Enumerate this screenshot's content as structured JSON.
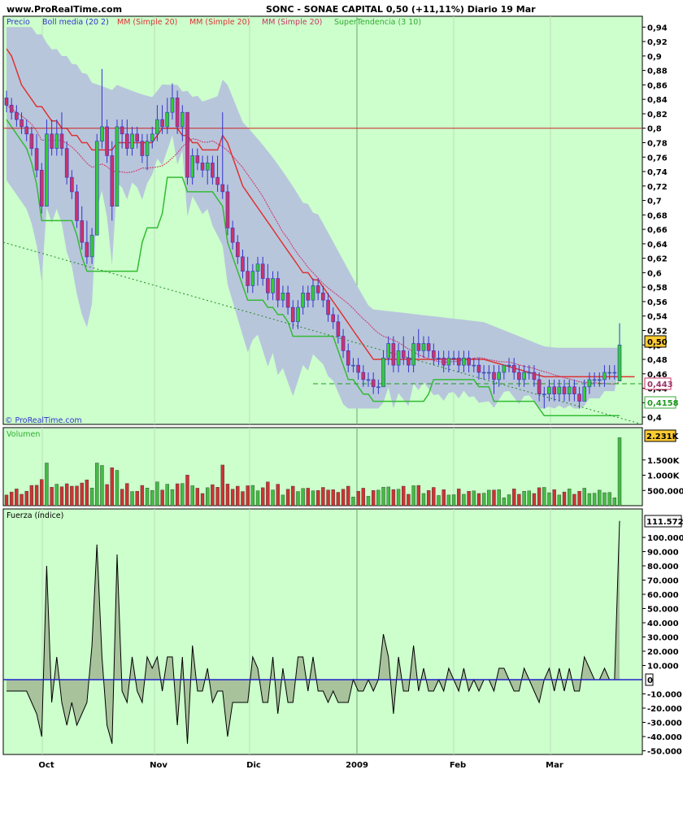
{
  "header": {
    "site": "www.ProRealTime.com",
    "title": "SONC - SONAE CAPITAL    0,50 (+11,11%)    Diario  19 Mar"
  },
  "legend": {
    "precio": "Precio",
    "boll": "Boll media (20 2)",
    "mm1": "MM (Simple 20)",
    "mm2": "MM (Simple 20)",
    "mm3": "MM (Simple 20)",
    "super": "SuperTendencia (3 10)"
  },
  "watermark": "© ProRealTime.com",
  "volume_label": "Volumen",
  "force_label": "Fuerza (índice)",
  "colors": {
    "panel_bg": "#ccffcc",
    "up": "#33cc33",
    "down": "#cc3366",
    "wick": "#3333cc",
    "band": "#b8c6dc",
    "mm_red": "#dd3333",
    "supertrend_green": "#33bb33",
    "boll_mid": "#cc3366",
    "vol_up": "#44bb44",
    "vol_down": "#cc3333"
  },
  "chart_data": [
    {
      "type": "candlestick",
      "title": "SONC - SONAE CAPITAL",
      "last_price": "0,50",
      "change": "+11,11%",
      "ylim": [
        0.39,
        0.955
      ],
      "y_ticks": [
        "0,94",
        "0,92",
        "0,9",
        "0,88",
        "0,86",
        "0,84",
        "0,82",
        "0,8",
        "0,78",
        "0,76",
        "0,74",
        "0,72",
        "0,7",
        "0,68",
        "0,66",
        "0,64",
        "0,62",
        "0,6",
        "0,58",
        "0,56",
        "0,54",
        "0,52",
        "0,5",
        "0,48",
        "0,46",
        "0,44",
        "0,42",
        "0,4"
      ],
      "x_labels": [
        "Oct",
        "Nov",
        "Dic",
        "2009",
        "Feb",
        "Mar"
      ],
      "price_tags": {
        "close": "0,50",
        "boll_mid": "0,443",
        "supertrend": "0,4158"
      },
      "horizontal_line": 0.8,
      "ohlc": [
        [
          0.842,
          0.852,
          0.822,
          0.832
        ],
        [
          0.832,
          0.842,
          0.812,
          0.822
        ],
        [
          0.822,
          0.832,
          0.802,
          0.812
        ],
        [
          0.812,
          0.822,
          0.792,
          0.802
        ],
        [
          0.802,
          0.812,
          0.782,
          0.792
        ],
        [
          0.792,
          0.802,
          0.762,
          0.772
        ],
        [
          0.772,
          0.792,
          0.732,
          0.742
        ],
        [
          0.742,
          0.752,
          0.682,
          0.692
        ],
        [
          0.692,
          0.812,
          0.692,
          0.792
        ],
        [
          0.792,
          0.812,
          0.762,
          0.772
        ],
        [
          0.772,
          0.812,
          0.762,
          0.792
        ],
        [
          0.792,
          0.822,
          0.762,
          0.772
        ],
        [
          0.772,
          0.782,
          0.722,
          0.732
        ],
        [
          0.732,
          0.742,
          0.702,
          0.712
        ],
        [
          0.712,
          0.722,
          0.662,
          0.672
        ],
        [
          0.672,
          0.692,
          0.632,
          0.642
        ],
        [
          0.642,
          0.672,
          0.612,
          0.622
        ],
        [
          0.622,
          0.662,
          0.612,
          0.652
        ],
        [
          0.652,
          0.792,
          0.652,
          0.782
        ],
        [
          0.782,
          0.882,
          0.772,
          0.802
        ],
        [
          0.802,
          0.812,
          0.752,
          0.762
        ],
        [
          0.762,
          0.782,
          0.672,
          0.692
        ],
        [
          0.692,
          0.812,
          0.692,
          0.802
        ],
        [
          0.802,
          0.812,
          0.772,
          0.792
        ],
        [
          0.792,
          0.812,
          0.762,
          0.772
        ],
        [
          0.772,
          0.802,
          0.762,
          0.792
        ],
        [
          0.792,
          0.802,
          0.772,
          0.782
        ],
        [
          0.782,
          0.792,
          0.752,
          0.762
        ],
        [
          0.762,
          0.792,
          0.742,
          0.782
        ],
        [
          0.782,
          0.802,
          0.772,
          0.792
        ],
        [
          0.792,
          0.832,
          0.782,
          0.812
        ],
        [
          0.812,
          0.832,
          0.792,
          0.802
        ],
        [
          0.802,
          0.842,
          0.792,
          0.822
        ],
        [
          0.822,
          0.862,
          0.812,
          0.842
        ],
        [
          0.842,
          0.852,
          0.792,
          0.802
        ],
        [
          0.802,
          0.832,
          0.782,
          0.822
        ],
        [
          0.822,
          0.822,
          0.722,
          0.732
        ],
        [
          0.732,
          0.772,
          0.722,
          0.762
        ],
        [
          0.762,
          0.772,
          0.742,
          0.752
        ],
        [
          0.752,
          0.762,
          0.732,
          0.742
        ],
        [
          0.742,
          0.762,
          0.722,
          0.752
        ],
        [
          0.752,
          0.762,
          0.722,
          0.732
        ],
        [
          0.732,
          0.762,
          0.712,
          0.722
        ],
        [
          0.722,
          0.822,
          0.702,
          0.712
        ],
        [
          0.712,
          0.722,
          0.652,
          0.662
        ],
        [
          0.662,
          0.672,
          0.632,
          0.642
        ],
        [
          0.642,
          0.652,
          0.612,
          0.622
        ],
        [
          0.622,
          0.632,
          0.592,
          0.602
        ],
        [
          0.602,
          0.622,
          0.572,
          0.582
        ],
        [
          0.582,
          0.612,
          0.572,
          0.602
        ],
        [
          0.602,
          0.622,
          0.582,
          0.612
        ],
        [
          0.612,
          0.622,
          0.582,
          0.592
        ],
        [
          0.592,
          0.612,
          0.562,
          0.572
        ],
        [
          0.572,
          0.602,
          0.562,
          0.592
        ],
        [
          0.592,
          0.602,
          0.552,
          0.562
        ],
        [
          0.562,
          0.582,
          0.552,
          0.572
        ],
        [
          0.572,
          0.582,
          0.542,
          0.552
        ],
        [
          0.552,
          0.562,
          0.522,
          0.532
        ],
        [
          0.532,
          0.562,
          0.522,
          0.552
        ],
        [
          0.552,
          0.582,
          0.542,
          0.572
        ],
        [
          0.572,
          0.582,
          0.552,
          0.562
        ],
        [
          0.562,
          0.592,
          0.552,
          0.582
        ],
        [
          0.582,
          0.592,
          0.562,
          0.572
        ],
        [
          0.572,
          0.582,
          0.552,
          0.562
        ],
        [
          0.562,
          0.572,
          0.532,
          0.542
        ],
        [
          0.542,
          0.552,
          0.522,
          0.532
        ],
        [
          0.532,
          0.542,
          0.502,
          0.512
        ],
        [
          0.512,
          0.522,
          0.482,
          0.492
        ],
        [
          0.492,
          0.502,
          0.462,
          0.472
        ],
        [
          0.472,
          0.482,
          0.462,
          0.472
        ],
        [
          0.472,
          0.482,
          0.452,
          0.462
        ],
        [
          0.462,
          0.472,
          0.442,
          0.452
        ],
        [
          0.452,
          0.462,
          0.442,
          0.452
        ],
        [
          0.452,
          0.462,
          0.432,
          0.442
        ],
        [
          0.442,
          0.452,
          0.432,
          0.442
        ],
        [
          0.442,
          0.492,
          0.442,
          0.482
        ],
        [
          0.482,
          0.512,
          0.472,
          0.502
        ],
        [
          0.502,
          0.512,
          0.462,
          0.472
        ],
        [
          0.472,
          0.502,
          0.462,
          0.492
        ],
        [
          0.492,
          0.512,
          0.472,
          0.482
        ],
        [
          0.482,
          0.492,
          0.462,
          0.472
        ],
        [
          0.472,
          0.512,
          0.462,
          0.502
        ],
        [
          0.502,
          0.522,
          0.482,
          0.492
        ],
        [
          0.492,
          0.512,
          0.482,
          0.502
        ],
        [
          0.502,
          0.512,
          0.482,
          0.492
        ],
        [
          0.492,
          0.502,
          0.472,
          0.482
        ],
        [
          0.482,
          0.492,
          0.472,
          0.482
        ],
        [
          0.482,
          0.492,
          0.462,
          0.472
        ],
        [
          0.472,
          0.492,
          0.462,
          0.482
        ],
        [
          0.482,
          0.492,
          0.472,
          0.482
        ],
        [
          0.482,
          0.492,
          0.462,
          0.472
        ],
        [
          0.472,
          0.492,
          0.462,
          0.482
        ],
        [
          0.482,
          0.492,
          0.462,
          0.472
        ],
        [
          0.472,
          0.482,
          0.462,
          0.472
        ],
        [
          0.472,
          0.482,
          0.452,
          0.462
        ],
        [
          0.462,
          0.472,
          0.452,
          0.462
        ],
        [
          0.462,
          0.472,
          0.452,
          0.462
        ],
        [
          0.462,
          0.472,
          0.432,
          0.452
        ],
        [
          0.452,
          0.472,
          0.442,
          0.462
        ],
        [
          0.462,
          0.472,
          0.452,
          0.472
        ],
        [
          0.472,
          0.482,
          0.462,
          0.472
        ],
        [
          0.472,
          0.482,
          0.452,
          0.462
        ],
        [
          0.462,
          0.472,
          0.442,
          0.452
        ],
        [
          0.452,
          0.472,
          0.442,
          0.462
        ],
        [
          0.462,
          0.472,
          0.452,
          0.462
        ],
        [
          0.462,
          0.472,
          0.442,
          0.452
        ],
        [
          0.452,
          0.462,
          0.422,
          0.432
        ],
        [
          0.432,
          0.442,
          0.412,
          0.432
        ],
        [
          0.432,
          0.452,
          0.422,
          0.442
        ],
        [
          0.442,
          0.452,
          0.422,
          0.432
        ],
        [
          0.432,
          0.452,
          0.422,
          0.442
        ],
        [
          0.442,
          0.452,
          0.422,
          0.432
        ],
        [
          0.432,
          0.452,
          0.422,
          0.442
        ],
        [
          0.442,
          0.452,
          0.422,
          0.432
        ],
        [
          0.432,
          0.442,
          0.412,
          0.422
        ],
        [
          0.422,
          0.452,
          0.422,
          0.442
        ],
        [
          0.442,
          0.462,
          0.432,
          0.452
        ],
        [
          0.452,
          0.462,
          0.442,
          0.452
        ],
        [
          0.452,
          0.462,
          0.442,
          0.452
        ],
        [
          0.452,
          0.472,
          0.442,
          0.462
        ],
        [
          0.462,
          0.472,
          0.452,
          0.462
        ],
        [
          0.462,
          0.472,
          0.452,
          0.462
        ],
        [
          0.45,
          0.53,
          0.45,
          0.5
        ]
      ],
      "mm20": [
        0.91,
        0.9,
        0.88,
        0.86,
        0.85,
        0.84,
        0.83,
        0.83,
        0.82,
        0.81,
        0.81,
        0.8,
        0.8,
        0.79,
        0.79,
        0.78,
        0.78,
        0.77,
        0.77,
        0.77,
        0.77,
        0.77,
        0.78,
        0.78,
        0.78,
        0.78,
        0.78,
        0.78,
        0.78,
        0.78,
        0.79,
        0.8,
        0.8,
        0.8,
        0.8,
        0.79,
        0.79,
        0.78,
        0.78,
        0.77,
        0.77,
        0.77,
        0.77,
        0.79,
        0.78,
        0.76,
        0.74,
        0.72,
        0.71,
        0.7,
        0.69,
        0.68,
        0.67,
        0.66,
        0.65,
        0.64,
        0.63,
        0.62,
        0.61,
        0.6,
        0.6,
        0.59,
        0.59,
        0.58,
        0.57,
        0.56,
        0.55,
        0.54,
        0.53,
        0.52,
        0.51,
        0.5,
        0.49,
        0.48,
        0.48,
        0.48,
        0.48,
        0.48,
        0.48,
        0.48,
        0.48,
        0.48,
        0.48,
        0.48,
        0.48,
        0.48,
        0.48,
        0.48,
        0.48,
        0.48,
        0.48,
        0.48,
        0.48,
        0.48,
        0.48,
        0.48,
        0.478,
        0.476,
        0.474,
        0.472,
        0.47,
        0.468,
        0.466,
        0.464,
        0.462,
        0.46,
        0.458,
        0.456,
        0.456,
        0.456,
        0.456,
        0.456,
        0.456,
        0.456,
        0.456,
        0.456,
        0.456,
        0.456,
        0.456,
        0.456,
        0.456,
        0.456,
        0.456,
        0.456,
        0.456,
        0.456
      ],
      "supertrend": [
        null,
        null,
        null,
        null,
        null,
        null,
        null,
        null,
        null,
        null,
        null,
        null,
        null,
        null,
        null,
        null,
        null,
        null,
        null,
        null,
        null,
        null,
        null,
        null,
        null,
        null,
        null,
        null,
        null,
        null,
        null,
        null,
        null,
        null,
        null,
        null,
        null,
        null,
        null,
        null,
        null,
        null,
        null,
        null,
        null,
        null,
        null,
        null,
        null,
        null,
        null,
        null,
        null,
        null,
        null,
        null,
        null,
        null,
        null,
        null,
        null,
        null,
        null,
        null,
        null,
        null,
        null,
        null,
        null,
        null,
        null,
        null,
        null,
        null,
        null,
        null,
        null,
        null,
        null,
        null,
        null,
        null,
        null,
        null,
        null,
        null,
        null,
        null,
        null,
        null,
        null,
        null,
        null,
        null,
        null,
        null,
        null,
        null,
        null,
        null,
        null,
        null,
        null,
        null,
        null,
        null,
        null,
        null,
        null,
        null,
        null,
        null,
        null,
        null,
        null,
        null,
        null,
        null,
        null,
        null,
        null,
        null,
        null,
        null,
        null,
        0.4158
      ],
      "bollinger_upper_max": 0.94,
      "bollinger_lower_min": 0.412
    },
    {
      "type": "bar",
      "title": "Volumen",
      "y_ticks": [
        "2.231K",
        "1.500K",
        "1.000K",
        "500.000"
      ],
      "last_value": "2.231K",
      "unit": "thousands"
    },
    {
      "type": "area",
      "title": "Fuerza (índice)",
      "ylim": [
        -52000,
        115000
      ],
      "y_ticks": [
        "100.000",
        "90.000",
        "80.000",
        "70.000",
        "60.000",
        "50.000",
        "40.000",
        "30.000",
        "20.000",
        "10.000",
        "0",
        "-10.000",
        "-20.000",
        "-30.000",
        "-40.000",
        "-50.000"
      ],
      "last_value": "111.572"
    }
  ]
}
